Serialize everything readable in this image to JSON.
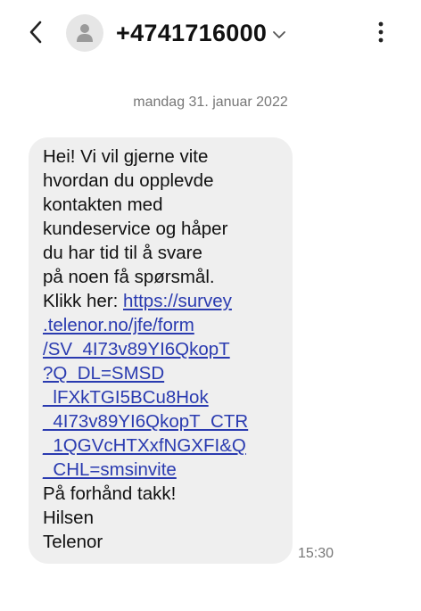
{
  "header": {
    "back_icon": "chevron-left-icon",
    "avatar_icon": "person-icon",
    "contact": "+4741716000",
    "dropdown_icon": "chevron-down-icon",
    "more_icon": "more-vertical-icon"
  },
  "conversation": {
    "date": "mandag 31. januar 2022",
    "message": {
      "lines": {
        "l1": "Hei! Vi vil gjerne vite",
        "l2": "hvordan du opplevde",
        "l3": "kontakten med",
        "l4": "kundeservice og håper",
        "l5": "du har tid til å svare",
        "l6": "på noen få spørsmål.",
        "l7_prefix": "Klikk her: ",
        "l7_link": "https://survey",
        "l8": ".telenor.no/jfe/form",
        "l9": "/SV_4I73v89YI6QkopT",
        "l10": "?Q_DL=SMSD",
        "l11": "_lFXkTGI5BCu8Hok",
        "l12": "_4I73v89YI6QkopT_CTR",
        "l13": "_1QGVcHTXxfNGXFI&Q",
        "l14": "_CHL=smsinvite",
        "l15": "På forhånd takk!",
        "l16": "Hilsen",
        "l17": "Telenor"
      },
      "time": "15:30"
    }
  },
  "colors": {
    "bubble": "#efefef",
    "link": "#2a3bb0",
    "meta_text": "#777777"
  }
}
